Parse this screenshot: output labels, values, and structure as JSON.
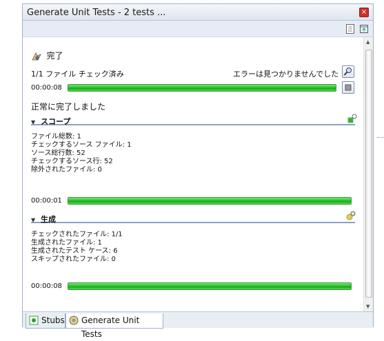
{
  "window": {
    "title": "Generate Unit Tests - 2 tests ...",
    "close_label": "×"
  },
  "status": {
    "icon": "completed-icon",
    "label": "完了",
    "files_checked": "1/1 ファイル チェック済み",
    "no_errors": "エラーは見つかりませんでした",
    "elapsed_main": "00:00:08",
    "success": "正常に完了しました"
  },
  "scope": {
    "heading": "スコープ",
    "lines": [
      "ファイル総数: 1",
      "チェックするソース ファイル: 1",
      "ソース総行数: 52",
      "チェックするソース行: 52",
      "除外されたファイル: 0"
    ],
    "elapsed": "00:00:01"
  },
  "generation": {
    "heading": "生成",
    "lines": [
      "チェックされたファイル: 1/1",
      "生成されたファイル: 1",
      "生成されたテスト ケース: 6",
      "スキップされたファイル: 0"
    ],
    "elapsed": "00:00:08"
  },
  "progress": {
    "main": 1.0,
    "scope": 1.0,
    "generation": 1.0
  },
  "tabs": [
    {
      "label": "Stubs",
      "icon": "stubs-icon",
      "active": false
    },
    {
      "label": "Generate Unit Tests",
      "icon": "generate-tests-icon",
      "active": true
    }
  ],
  "colors": {
    "progress_green": "#21c421",
    "section_rule": "#8aa0c6"
  }
}
